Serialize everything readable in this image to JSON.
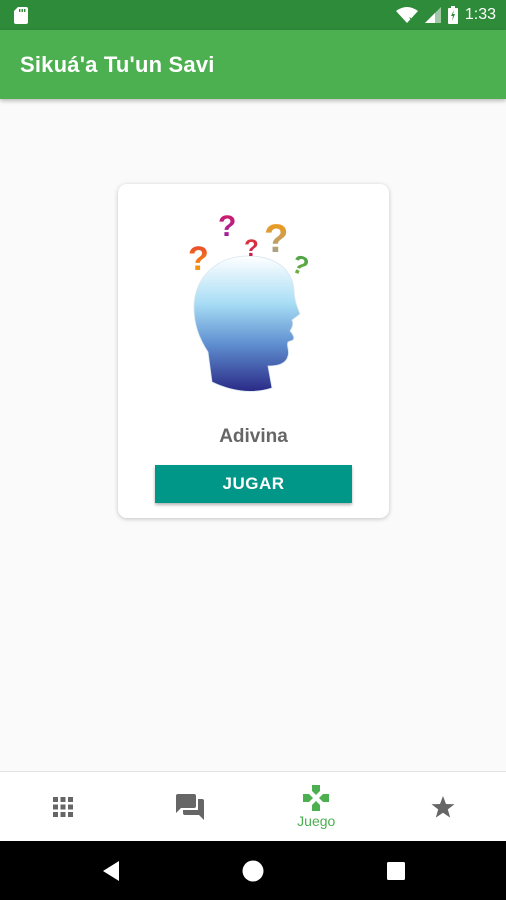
{
  "status_bar": {
    "time": "1:33",
    "icons": [
      "sd-card-icon",
      "wifi-icon",
      "signal-icon",
      "battery-icon"
    ]
  },
  "app_bar": {
    "title": "Sikuá'a Tu'un Savi"
  },
  "card": {
    "illustration": "thinking-head-icon",
    "title": "Adivina",
    "button_label": "JUGAR"
  },
  "bottom_nav": {
    "active_index": 2,
    "items": [
      {
        "icon": "grid-icon",
        "label": ""
      },
      {
        "icon": "chat-icon",
        "label": ""
      },
      {
        "icon": "gamepad-icon",
        "label": "Juego"
      },
      {
        "icon": "star-icon",
        "label": ""
      }
    ]
  },
  "system_nav": {
    "buttons": [
      "back-icon",
      "home-icon",
      "recents-icon"
    ]
  },
  "colors": {
    "status_bar": "#2e8b3a",
    "app_bar": "#4caf50",
    "button": "#009688",
    "active_nav": "#4caf50",
    "inactive_nav": "#666666"
  }
}
